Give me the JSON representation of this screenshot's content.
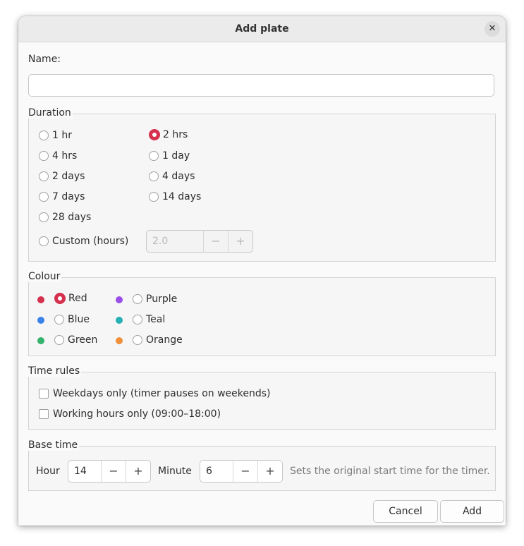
{
  "dialog": {
    "title": "Add plate",
    "close_glyph": "✕"
  },
  "name": {
    "label": "Name:",
    "value": "",
    "placeholder": ""
  },
  "duration": {
    "legend": "Duration",
    "options": [
      "1 hr",
      "2 hrs",
      "4 hrs",
      "1 day",
      "2 days",
      "4 days",
      "7 days",
      "14 days",
      "28 days",
      "Custom (hours)"
    ],
    "selected": "2 hrs",
    "custom_value": "2.0"
  },
  "colour": {
    "legend": "Colour",
    "options": [
      {
        "label": "Red",
        "color": "#d5304e"
      },
      {
        "label": "Purple",
        "color": "#9b4de8"
      },
      {
        "label": "Blue",
        "color": "#3b82e8"
      },
      {
        "label": "Teal",
        "color": "#26b0b5"
      },
      {
        "label": "Green",
        "color": "#33b36b"
      },
      {
        "label": "Orange",
        "color": "#f0903a"
      }
    ],
    "selected": "Red"
  },
  "time_rules": {
    "legend": "Time rules",
    "weekdays_label": "Weekdays only (timer pauses on weekends)",
    "working_hours_label": "Working hours only (09:00–18:00)"
  },
  "base_time": {
    "legend": "Base time",
    "hour_label": "Hour",
    "hour_value": "14",
    "minute_label": "Minute",
    "minute_value": "6",
    "hint": "Sets the original start time for the timer."
  },
  "stepper": {
    "minus": "−",
    "plus": "+"
  },
  "buttons": {
    "cancel": "Cancel",
    "add": "Add"
  }
}
